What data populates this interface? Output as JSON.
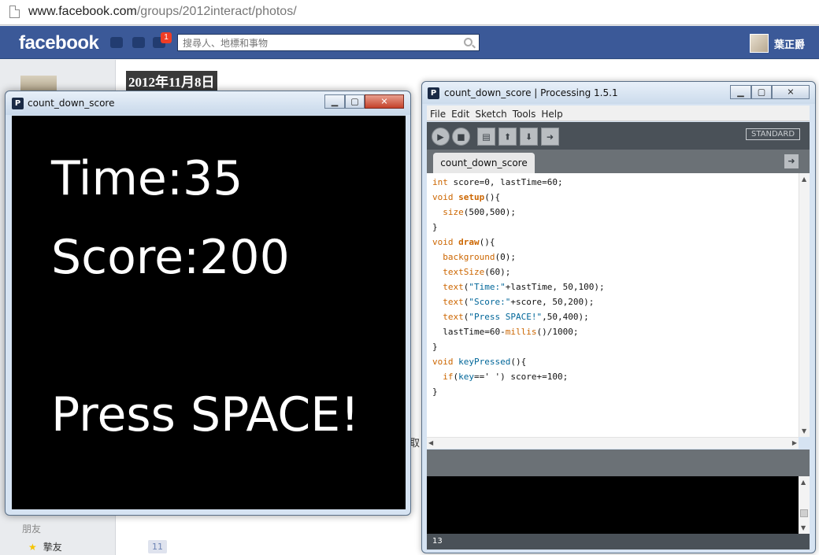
{
  "browser": {
    "url_domain": "www.facebook.com",
    "url_path": "/groups/2012interact/photos/"
  },
  "facebook": {
    "logo": "facebook",
    "notification_count": "1",
    "search_placeholder": "搜尋人、地標和事物",
    "username": "葉正爵",
    "date_heading": "2012年11月8日",
    "partial_text": "取",
    "friends_section": "朋友",
    "friends_item_label": "摯友",
    "friends_item_count": "11"
  },
  "sketch_window": {
    "title": "count_down_score",
    "icon": "P",
    "canvas_lines": [
      "Time:35",
      "Score:200",
      "Press SPACE!"
    ]
  },
  "ide_window": {
    "title": "count_down_score | Processing 1.5.1",
    "icon": "P",
    "menu": [
      "File",
      "Edit",
      "Sketch",
      "Tools",
      "Help"
    ],
    "toolbar_icons": [
      "run-icon",
      "stop-icon",
      "new-icon",
      "open-icon",
      "save-icon",
      "export-icon"
    ],
    "mode_label": "STANDARD",
    "tab_label": "count_down_score",
    "code_lines": [
      "int score=0, lastTime=60;",
      "void setup(){",
      "  size(500,500);",
      "}",
      "void draw(){",
      "  background(0);",
      "  textSize(60);",
      "  text(\"Time:\"+lastTime, 50,100);",
      "  text(\"Score:\"+score, 50,200);",
      "  text(\"Press SPACE!\",50,400);",
      "  lastTime=60-millis()/1000;",
      "}",
      "void keyPressed(){",
      "  if(key==' ') score+=100;",
      "}"
    ],
    "line_number": "13"
  }
}
